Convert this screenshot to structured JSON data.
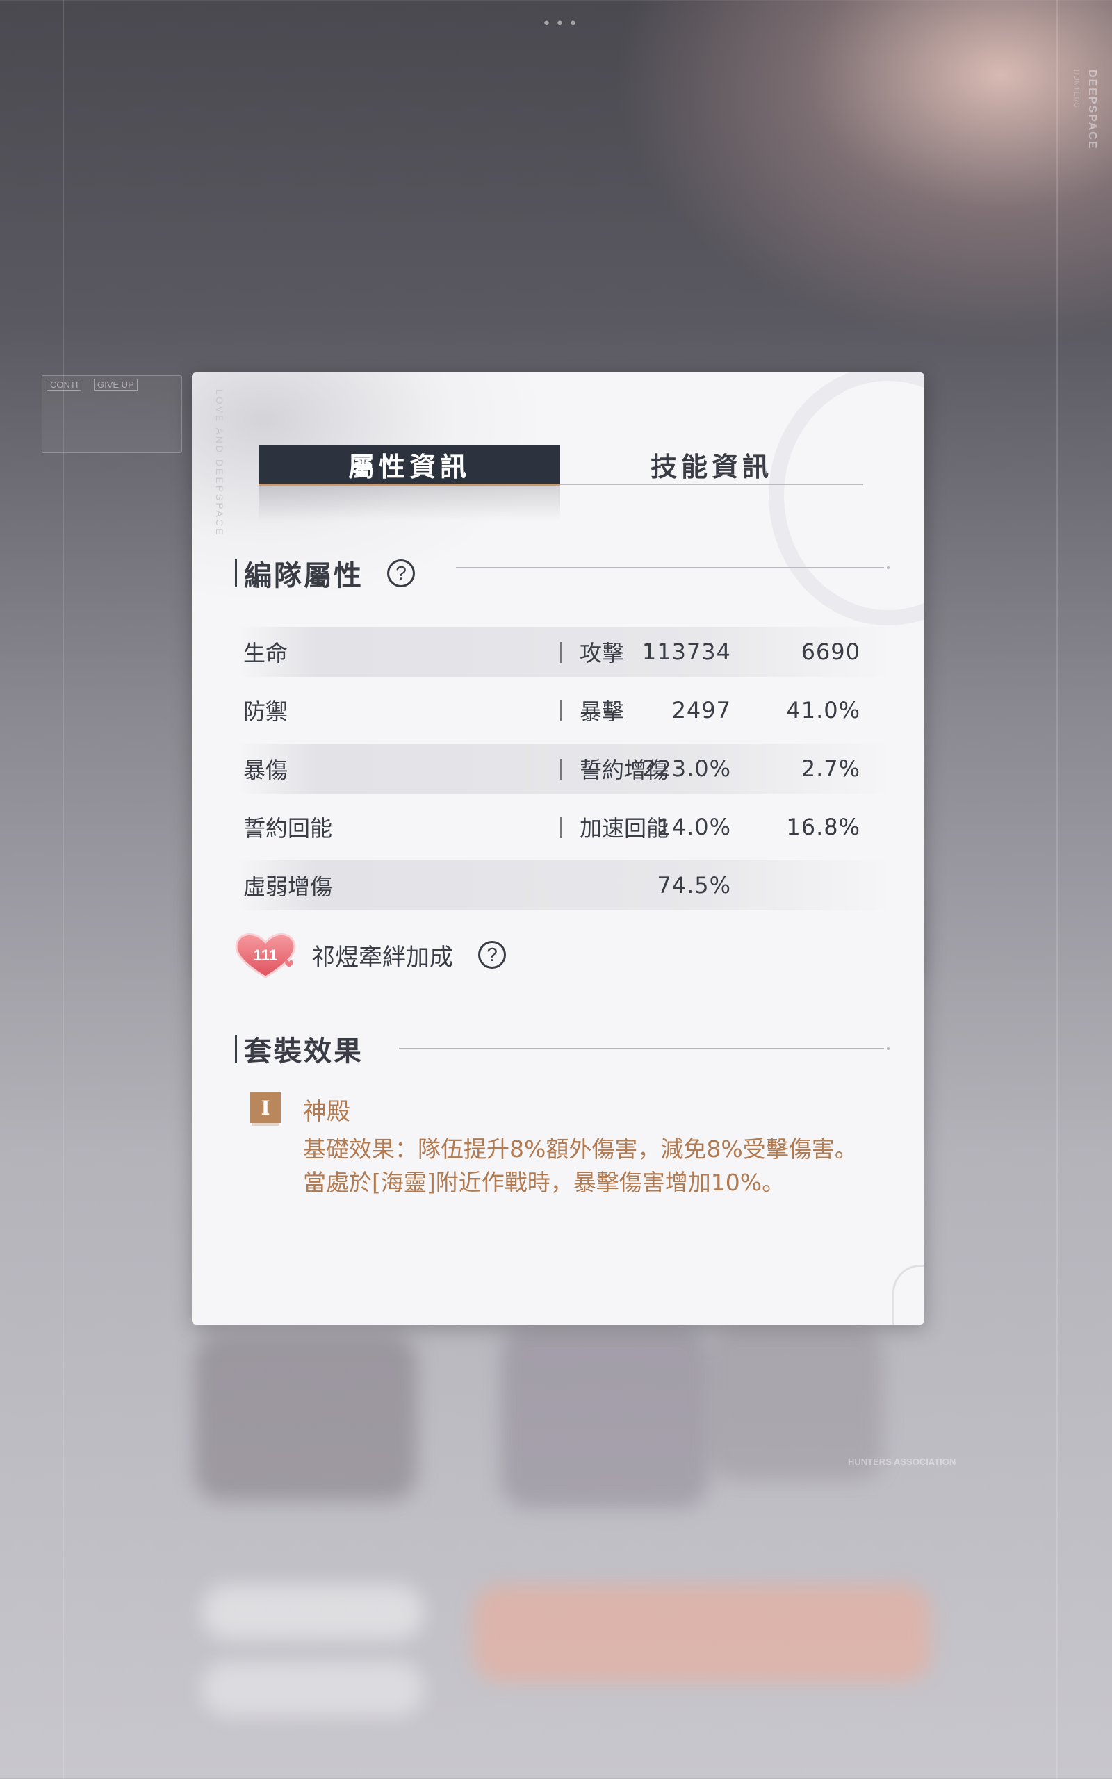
{
  "background": {
    "vertical_brand": "DEEPSPACE",
    "vertical_brand_sub": "HUNTERS",
    "small_tags": [
      "CONTI",
      "GIVE UP"
    ],
    "bottom_right_text": "HUNTERS ASSOCIATION",
    "dots": "•••"
  },
  "panel": {
    "vertical_text": "LOVE AND DEEPSPACE",
    "tabs": [
      {
        "label": "屬性資訊",
        "active": true
      },
      {
        "label": "技能資訊",
        "active": false
      }
    ],
    "team_attributes": {
      "title": "編隊屬性",
      "help_icon": "question-circle-icon",
      "help_symbol": "?",
      "stats": [
        {
          "left_label": "生命",
          "left_value": "113734",
          "right_label": "攻擊",
          "right_value": "6690"
        },
        {
          "left_label": "防禦",
          "left_value": "2497",
          "right_label": "暴擊",
          "right_value": "41.0%"
        },
        {
          "left_label": "暴傷",
          "left_value": "223.0%",
          "right_label": "誓約增傷",
          "right_value": "2.7%"
        },
        {
          "left_label": "誓約回能",
          "left_value": "14.0%",
          "right_label": "加速回能",
          "right_value": "16.8%"
        },
        {
          "left_label": "虛弱增傷",
          "left_value": "74.5%",
          "right_label": "",
          "right_value": ""
        }
      ]
    },
    "bond_bonus": {
      "label": "祁煜牽絆加成",
      "icon": "heart-badge-icon",
      "badge_text": "111"
    },
    "set_effect": {
      "title": "套裝效果",
      "badge": "I",
      "name": "神殿",
      "description": "基礎效果：隊伍提升8%額外傷害，減免8%受擊傷害。當處於[海靈]附近作戰時，暴擊傷害增加10%。"
    }
  },
  "colors": {
    "tab_active_bg": "#2c333e",
    "tab_accent": "#c49a78",
    "set_text": "#b17a50",
    "set_badge": "#b9875b"
  }
}
